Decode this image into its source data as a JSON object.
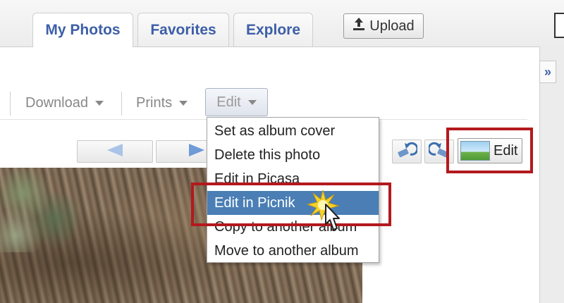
{
  "tabs": [
    {
      "label": "My Photos",
      "active": true
    },
    {
      "label": "Favorites",
      "active": false
    },
    {
      "label": "Explore",
      "active": false
    }
  ],
  "upload_label": "Upload",
  "toolbar": {
    "download_label": "Download",
    "prints_label": "Prints",
    "edit_label": "Edit"
  },
  "dropdown_items": [
    "Set as album cover",
    "Delete this photo",
    "Edit in Picasa",
    "Edit in Picnik",
    "Copy to another album",
    "Move to another album"
  ],
  "hovered_item": "Edit in Picnik",
  "photo_edit_label": "Edit",
  "colors": {
    "tab_text": "#3d5fa8",
    "menu_hover": "#4a7eb5",
    "highlight_red": "#b3191d"
  },
  "icons": [
    "upload-icon",
    "caret-down-icon",
    "prev-arrow-icon",
    "next-arrow-icon",
    "rotate-left-icon",
    "rotate-right-icon",
    "landscape-icon",
    "collapse-panel-icon",
    "sparkle-icon",
    "hand-cursor-icon"
  ]
}
